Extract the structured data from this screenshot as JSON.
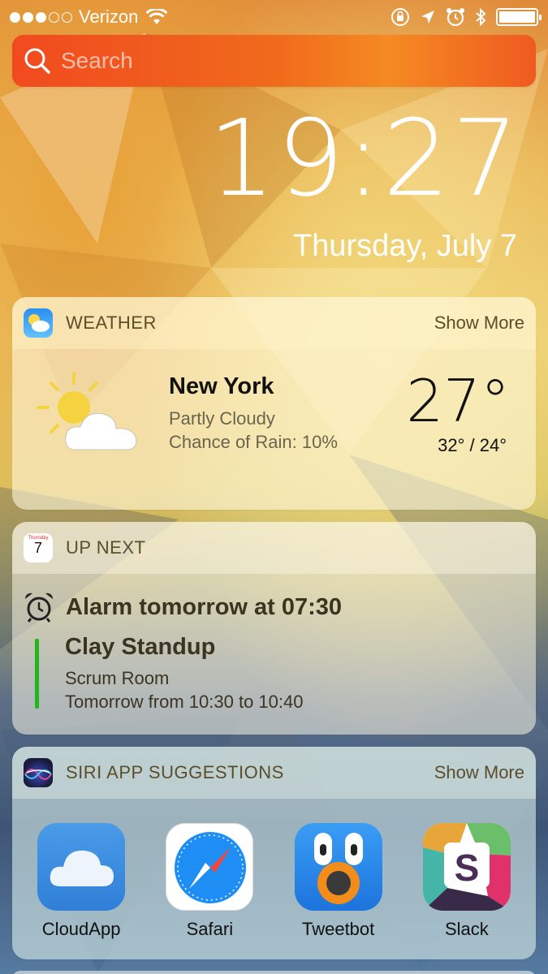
{
  "status_bar": {
    "carrier": "Verizon",
    "signal_bars_filled": 3,
    "signal_bars_total": 5,
    "battery_level": 1.0
  },
  "search": {
    "placeholder": "Search"
  },
  "lock": {
    "time": "19:27",
    "date": "Thursday, July 7"
  },
  "weather": {
    "title": "WEATHER",
    "show_more": "Show More",
    "city": "New York",
    "condition": "Partly Cloudy",
    "rain": "Chance of Rain: 10%",
    "temp": "27°",
    "hilo": "32° / 24°",
    "icon": "partly-cloudy-icon"
  },
  "upnext": {
    "title": "UP NEXT",
    "calendar_day": "Thursday",
    "calendar_num": "7",
    "alarm": "Alarm tomorrow at 07:30",
    "event_title": "Clay Standup",
    "event_room": "Scrum Room",
    "event_time": "Tomorrow from 10:30 to 10:40",
    "event_color": "#23b51e"
  },
  "siri": {
    "title": "SIRI APP SUGGESTIONS",
    "show_more": "Show More",
    "apps": [
      {
        "label": "CloudApp",
        "icon": "cloudapp-icon"
      },
      {
        "label": "Safari",
        "icon": "safari-icon"
      },
      {
        "label": "Tweetbot",
        "icon": "tweetbot-icon"
      },
      {
        "label": "Slack",
        "icon": "slack-icon"
      }
    ]
  }
}
